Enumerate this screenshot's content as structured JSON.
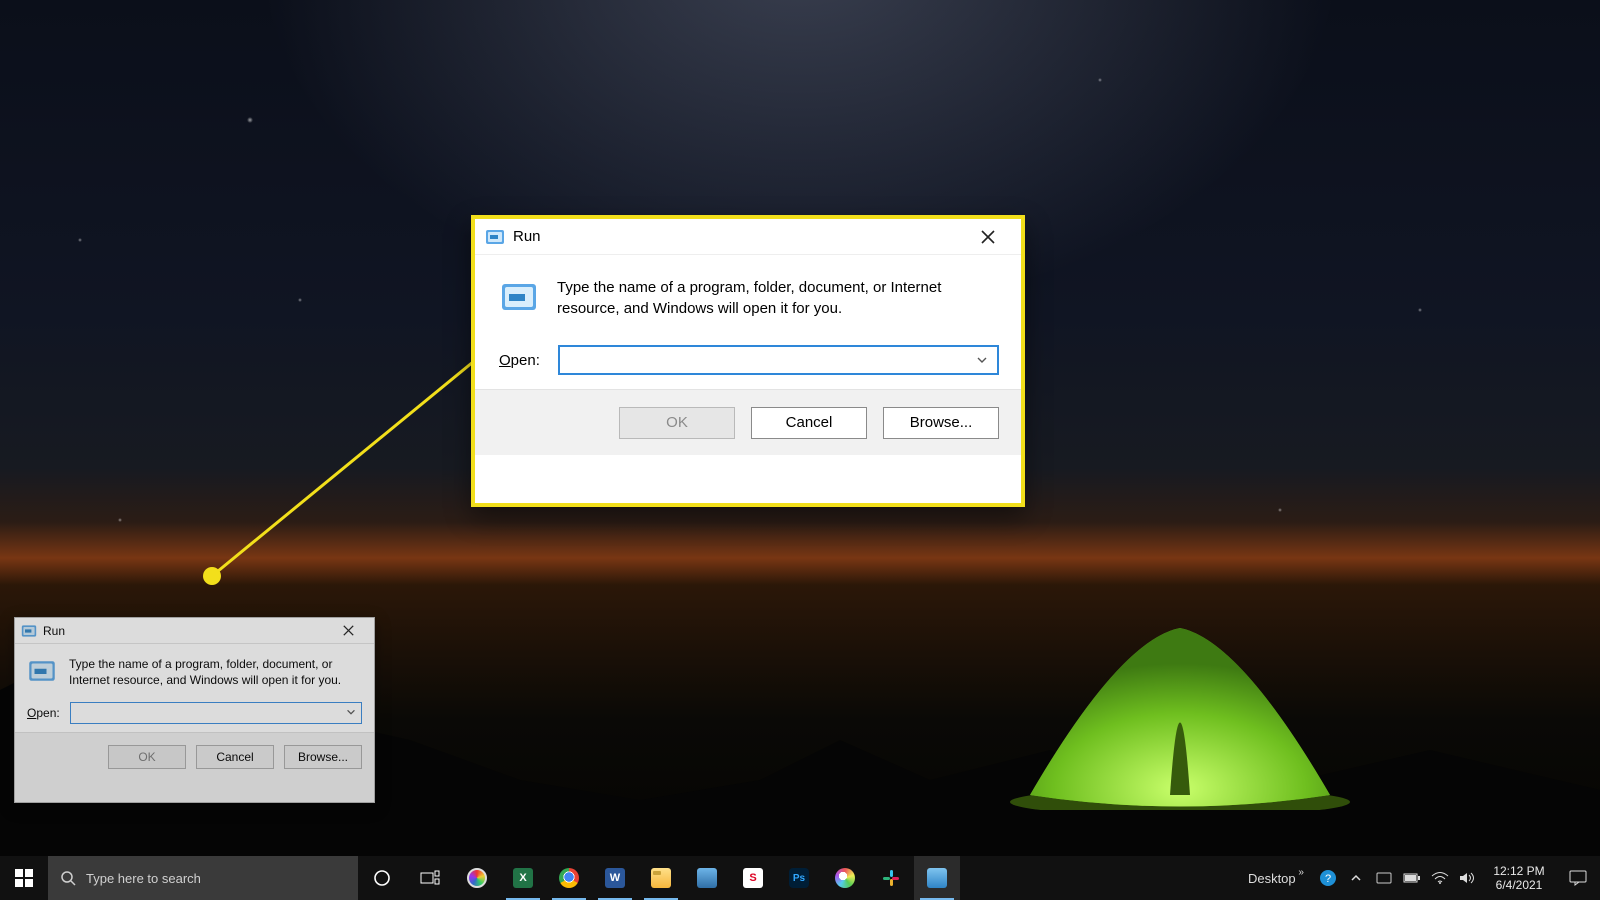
{
  "run_dialog": {
    "title": "Run",
    "description": "Type the name of a program, folder, document, or Internet resource, and Windows will open it for you.",
    "open_label_prefix": "O",
    "open_label_rest": "pen:",
    "input_value": "",
    "buttons": {
      "ok": "OK",
      "cancel": "Cancel",
      "browse_prefix": "B",
      "browse_rest": "rowse..."
    }
  },
  "taskbar": {
    "search_placeholder": "Type here to search",
    "toolbar_label": "Desktop",
    "time": "12:12 PM",
    "date": "6/4/2021"
  }
}
